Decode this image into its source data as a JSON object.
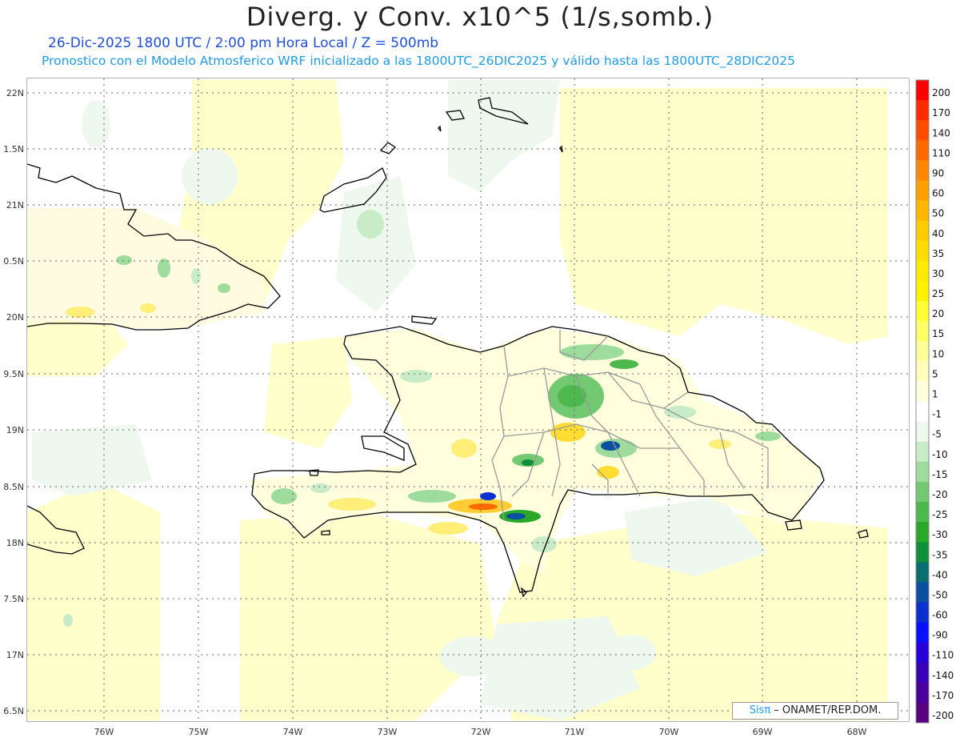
{
  "header": {
    "title": "Diverg. y Conv. x10^5 (1/s,somb.)",
    "line1": "26-Dic-2025  1800 UTC / 2:00 pm Hora Local / Z = 500mb",
    "line2": "Pronostico con el Modelo Atmosferico WRF inicializado a las 1800UTC_26DIC2025 y válido hasta las  1800UTC_28DIC2025"
  },
  "axes": {
    "lat_labels": [
      "22N",
      "1.5N",
      "21N",
      "0.5N",
      "20N",
      "9.5N",
      "19N",
      "8.5N",
      "18N",
      "7.5N",
      "17N",
      "6.5N"
    ],
    "lon_labels": [
      "76W",
      "75W",
      "74W",
      "73W",
      "72W",
      "71W",
      "70W",
      "69W",
      "68W"
    ]
  },
  "colorbar": {
    "labels": [
      "200",
      "170",
      "140",
      "110",
      "90",
      "60",
      "50",
      "40",
      "35",
      "30",
      "25",
      "20",
      "15",
      "10",
      "5",
      "1",
      "-1",
      "-5",
      "-10",
      "-15",
      "-20",
      "-25",
      "-30",
      "-35",
      "-40",
      "-50",
      "-60",
      "-90",
      "-110",
      "-140",
      "-170",
      "-200"
    ],
    "colors": [
      "#ff0000",
      "#ff2a00",
      "#ff4d00",
      "#ff6a00",
      "#ff8800",
      "#ffa000",
      "#ffb700",
      "#ffcc00",
      "#ffdd00",
      "#ffea00",
      "#fff200",
      "#ffff33",
      "#ffff66",
      "#ffff99",
      "#ffffbb",
      "#ffffdd",
      "#ffffff",
      "#eef8ee",
      "#c8ecc8",
      "#9edc9e",
      "#72c972",
      "#4db84d",
      "#2aa82a",
      "#0f8f3a",
      "#0a6e6e",
      "#0a4fa0",
      "#0a30d0",
      "#0a10ff",
      "#2800d8",
      "#3a00b8",
      "#4a0098",
      "#580080"
    ]
  },
  "credit": {
    "brand": "Sisπ",
    "text": " – ONAMET/REP.DOM."
  }
}
